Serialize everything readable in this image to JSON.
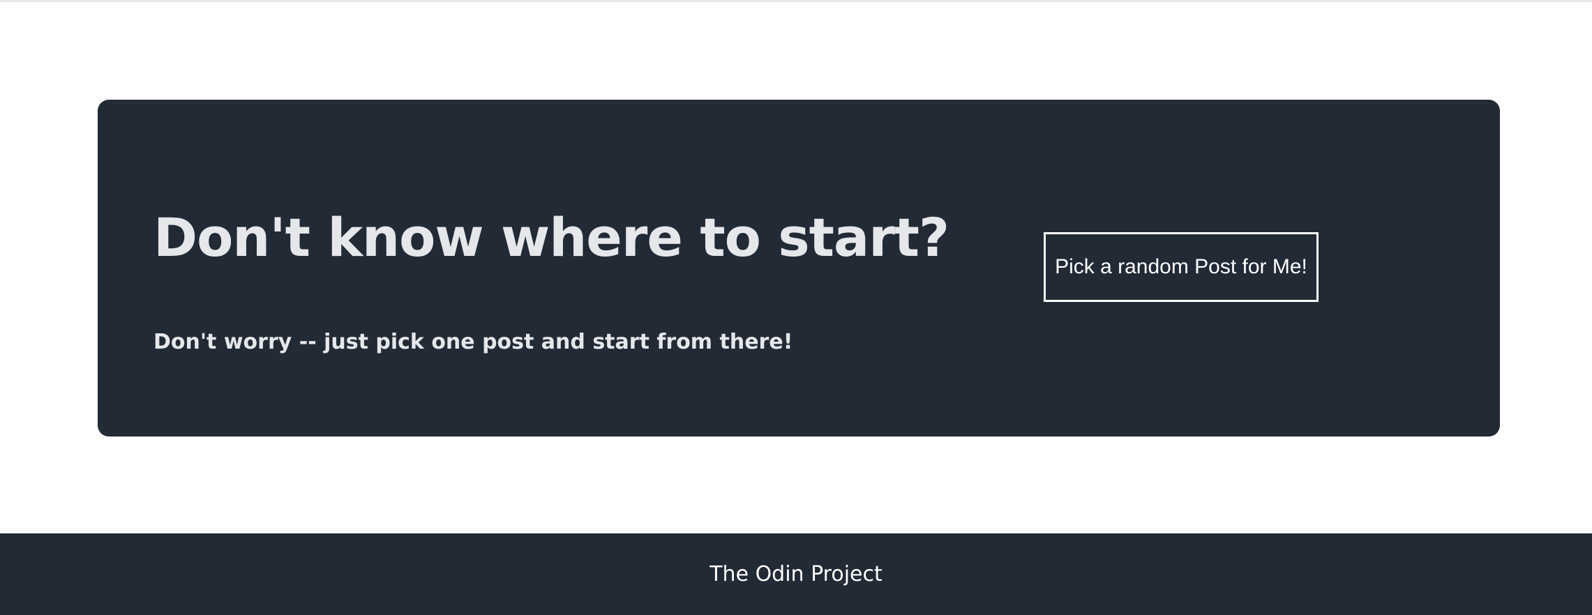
{
  "hero": {
    "title": "Don't know where to start?",
    "subtitle": "Don't worry -- just pick one post and start from there!",
    "button_label": "Pick a random Post for Me!"
  },
  "footer": {
    "text": "The Odin Project"
  },
  "colors": {
    "panel_background": "#222a36",
    "heading_text": "#e5e7eb",
    "button_border": "#ffffff",
    "page_background": "#ffffff"
  }
}
